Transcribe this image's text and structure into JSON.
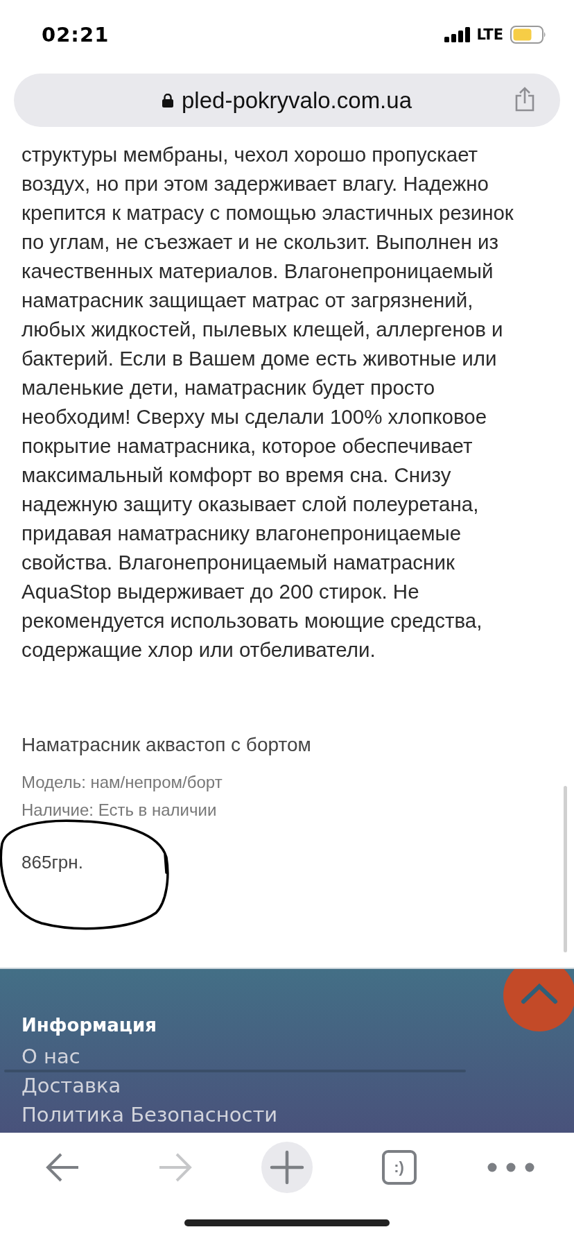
{
  "status_bar": {
    "time": "02:21",
    "network": "LTE"
  },
  "address_bar": {
    "url": "pled-pokryvalo.com.ua"
  },
  "description": "структуры мембраны, чехол хорошо пропускает воздух, но при этом задерживает влагу. Надежно крепится к матрасу с помощью эластичных резинок по углам, не съезжает и не скользит. Выполнен из качественных материалов. Влагонепроницаемый наматрасник защищает матрас от загрязнений, любых жидкостей, пылевых клещей, аллергенов и бактерий. Если в Вашем доме есть животные или маленькие дети, наматрасник будет просто необходим! Сверху мы сделали 100% хлопковое покрытие наматрасника, которое обеспечивает максимальный комфорт во время сна. Снизу надежную защиту оказывает слой полеуретана, придавая наматраснику влагонепроницаемые свойства. Влагонепроницаемый наматрасник AquaStop выдерживает до 200 стирок. Не рекомендуется использовать моющие средства, содержащие хлор или отбеливатели.",
  "product": {
    "title": "Наматрасник аквастоп с бортом",
    "model": "Модель: нам/непром/борт",
    "availability": "Наличие: Есть в наличии",
    "price": "865грн."
  },
  "footer": {
    "heading": "Информация",
    "links": [
      "О нас",
      "Доставка",
      "Политика Безопасности"
    ]
  },
  "toolbar": [
    {
      "kind": "back",
      "disabled": false
    },
    {
      "kind": "forward",
      "disabled": true
    },
    {
      "kind": "new-tab",
      "disabled": false
    },
    {
      "kind": "tabs",
      "label": ":)",
      "disabled": false
    },
    {
      "kind": "more",
      "disabled": false
    }
  ]
}
